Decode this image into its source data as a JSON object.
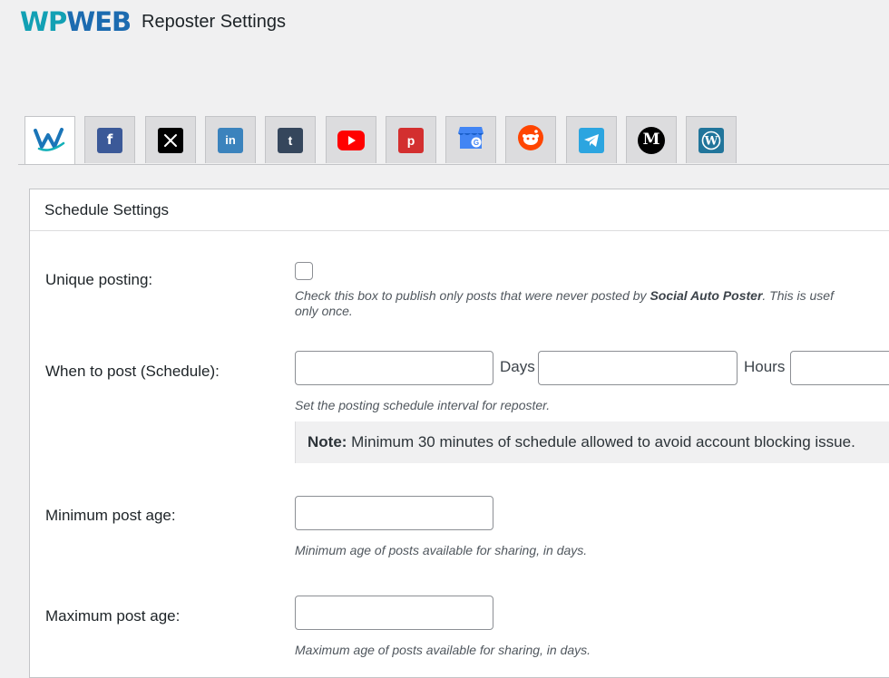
{
  "header": {
    "logo_part1": "WP",
    "logo_part2": "WEB",
    "title": "Reposter Settings"
  },
  "tabs": [
    {
      "name": "wpweb",
      "icon": "wpweb-logo-icon",
      "active": true
    },
    {
      "name": "facebook",
      "icon": "facebook-icon",
      "color": "#3b5998"
    },
    {
      "name": "x-twitter",
      "icon": "x-icon",
      "color": "#000000"
    },
    {
      "name": "linkedin",
      "icon": "linkedin-icon",
      "color": "#3b83bd"
    },
    {
      "name": "tumblr",
      "icon": "tumblr-icon",
      "color": "#35465c"
    },
    {
      "name": "youtube",
      "icon": "youtube-icon",
      "color": "#ff0000"
    },
    {
      "name": "pinterest",
      "icon": "pinterest-icon",
      "color": "#d32f2f"
    },
    {
      "name": "google-business",
      "icon": "google-business-icon",
      "color": "#4285f4"
    },
    {
      "name": "reddit",
      "icon": "reddit-icon",
      "color": "#ff4500"
    },
    {
      "name": "telegram",
      "icon": "telegram-icon",
      "color": "#2ca5e0"
    },
    {
      "name": "medium",
      "icon": "medium-icon",
      "color": "#000000"
    },
    {
      "name": "wordpress",
      "icon": "wordpress-icon",
      "color": "#21759b"
    }
  ],
  "panel": {
    "title": "Schedule Settings",
    "unique": {
      "label": "Unique posting:",
      "desc_pre": "Check this box to publish only posts that were never posted by ",
      "desc_bold": "Social Auto Poster",
      "desc_post": ". This is usef",
      "desc_line2": "only once.",
      "checked": false
    },
    "schedule": {
      "label": "When to post (Schedule):",
      "days_value": "",
      "days_unit": "Days",
      "hours_value": "",
      "hours_unit": "Hours",
      "minutes_value": "",
      "desc": "Set the posting schedule interval for reposter.",
      "note_label": "Note:",
      "note_text": " Minimum 30 minutes of schedule allowed to avoid account blocking issue."
    },
    "min_age": {
      "label": "Minimum post age:",
      "value": "",
      "desc": "Minimum age of posts available for sharing, in days."
    },
    "max_age": {
      "label": "Maximum post age:",
      "value": "",
      "desc": "Maximum age of posts available for sharing, in days."
    }
  }
}
